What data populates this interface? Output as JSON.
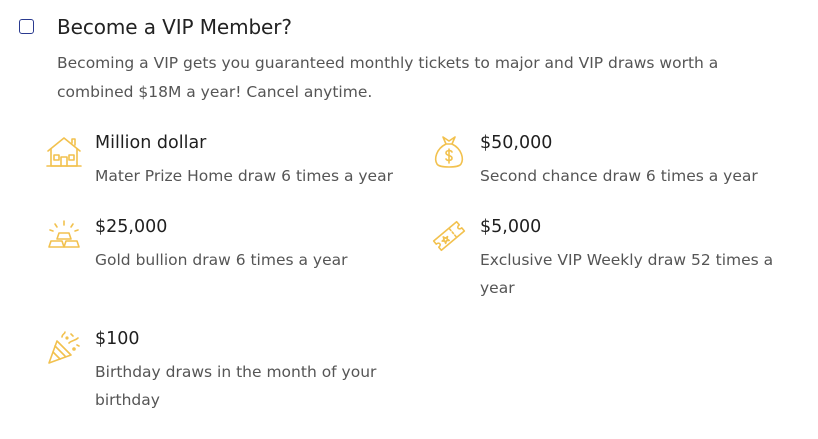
{
  "vip": {
    "checkbox_checked": false,
    "title": "Become a VIP Member?",
    "description": "Becoming a VIP gets you guaranteed monthly tickets to major and VIP draws worth a combined $18M a year! Cancel anytime."
  },
  "accent_color": "#f2c14e",
  "benefits": [
    {
      "icon": "house-icon",
      "title": "Million dollar",
      "description": "Mater Prize Home draw 6 times a year"
    },
    {
      "icon": "money-bag-icon",
      "title": "$50,000",
      "description": "Second chance draw 6 times a year"
    },
    {
      "icon": "gold-bars-icon",
      "title": "$25,000",
      "description": "Gold bullion draw 6 times a year"
    },
    {
      "icon": "ticket-icon",
      "title": "$5,000",
      "description": "Exclusive VIP Weekly draw 52 times a year"
    },
    {
      "icon": "party-popper-icon",
      "title": "$100",
      "description": "Birthday draws in the month of your birthday"
    }
  ]
}
